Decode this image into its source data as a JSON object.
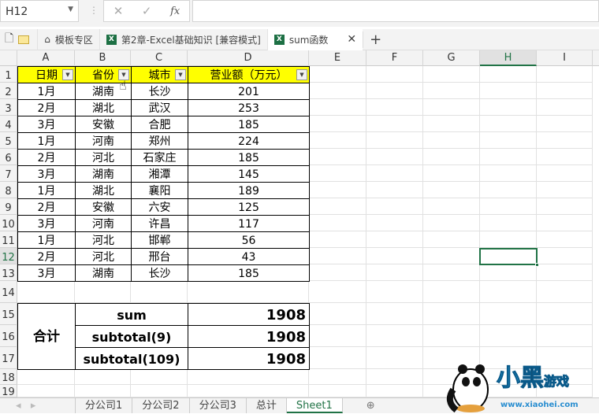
{
  "formula_bar": {
    "name_box": "H12",
    "cancel_icon": "✕",
    "enter_icon": "✓",
    "fx_label": "fx",
    "formula": ""
  },
  "doc_tabs": [
    {
      "label": "模板专区",
      "icon": "home-icon"
    },
    {
      "label": "第2章-Excel基础知识  [兼容模式]",
      "icon": "excel-icon"
    },
    {
      "label": "sum函数",
      "icon": "excel-icon",
      "active": true
    }
  ],
  "columns": [
    "A",
    "B",
    "C",
    "D",
    "E",
    "F",
    "G",
    "H",
    "I"
  ],
  "selected_cell": "H12",
  "header_row": [
    "日期",
    "省份",
    "城市",
    "营业额（万元）"
  ],
  "rows": [
    [
      "1月",
      "湖南",
      "长沙",
      "201"
    ],
    [
      "2月",
      "湖北",
      "武汉",
      "253"
    ],
    [
      "3月",
      "安徽",
      "合肥",
      "185"
    ],
    [
      "1月",
      "河南",
      "郑州",
      "224"
    ],
    [
      "2月",
      "河北",
      "石家庄",
      "185"
    ],
    [
      "3月",
      "湖南",
      "湘潭",
      "145"
    ],
    [
      "1月",
      "湖北",
      "襄阳",
      "189"
    ],
    [
      "2月",
      "安徽",
      "六安",
      "125"
    ],
    [
      "3月",
      "河南",
      "许昌",
      "117"
    ],
    [
      "1月",
      "河北",
      "邯郸",
      "56"
    ],
    [
      "2月",
      "河北",
      "邢台",
      "43"
    ],
    [
      "3月",
      "湖南",
      "长沙",
      "185"
    ]
  ],
  "summary": {
    "label": "合计",
    "items": [
      {
        "name": "sum",
        "value": "1908"
      },
      {
        "name": "subtotal(9)",
        "value": "1908"
      },
      {
        "name": "subtotal(109)",
        "value": "1908"
      }
    ]
  },
  "sheet_tabs": [
    "分公司1",
    "分公司2",
    "分公司3",
    "总计",
    "Sheet1"
  ],
  "active_sheet": "Sheet1",
  "watermark": {
    "text": "小黑游戏",
    "url": "www.xiaohei.com"
  },
  "colors": {
    "header_fill": "#ffff00",
    "accent": "#217346"
  }
}
